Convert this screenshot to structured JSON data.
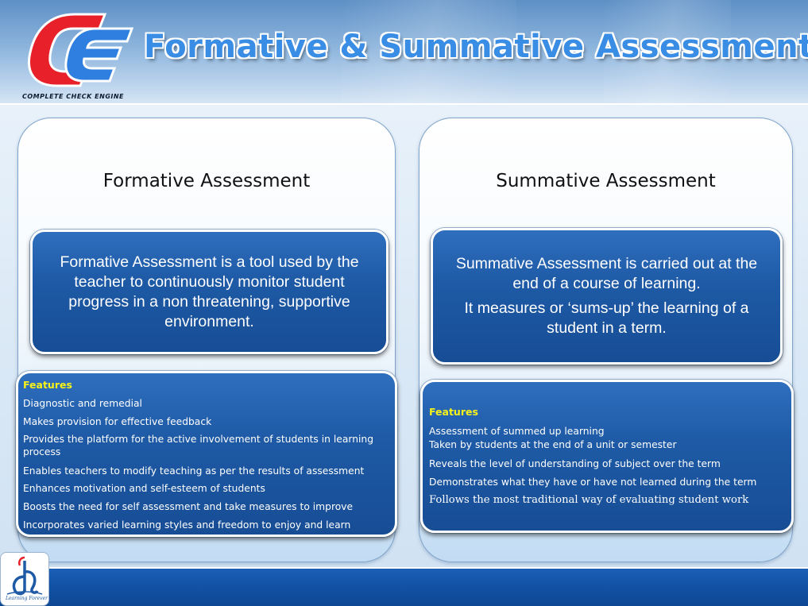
{
  "header": {
    "title": "Formative & Summative Assessments",
    "logo_text": "COMPLETE CHECK ENGINE"
  },
  "left": {
    "heading": "Formative Assessment",
    "definition": "Formative Assessment is a tool used by the teacher to continuously monitor student progress in a non threatening, supportive environment.",
    "features_label": "Features",
    "features": [
      "Diagnostic and remedial",
      "Makes provision for effective feedback",
      "Provides the platform for the active involvement of students in learning process",
      "Enables teachers to modify teaching as per the  results of assessment",
      "Enhances motivation and self-esteem of students",
      "Boosts the need for self assessment and take measures to improve",
      "Incorporates varied learning styles and freedom to enjoy and learn"
    ]
  },
  "right": {
    "heading": "Summative Assessment",
    "definition_1": "Summative Assessment is carried out at the end of a course of learning.",
    "definition_2": "It measures or ‘sums-up’ the learning of a student in a term.",
    "features_label": "Features",
    "features": [
      "Assessment of summed up learning",
      "Taken by students at the end of a unit or semester",
      "Reveals the level of understanding of subject over the term",
      "Demonstrates what they have or have not learned during the term",
      "Follows the most traditional way of evaluating student work"
    ]
  },
  "footer": {
    "logo_text": "Learning Forever"
  },
  "colors": {
    "title": "#3a8de4",
    "box_blue": "#1e5aa6",
    "features_label": "#f7f21a",
    "footer": "#1251a3",
    "logo_red": "#e8202a",
    "logo_blue": "#2f7fe0"
  },
  "icons": [
    "cce-logo-icon",
    "learning-forever-logo-icon"
  ]
}
